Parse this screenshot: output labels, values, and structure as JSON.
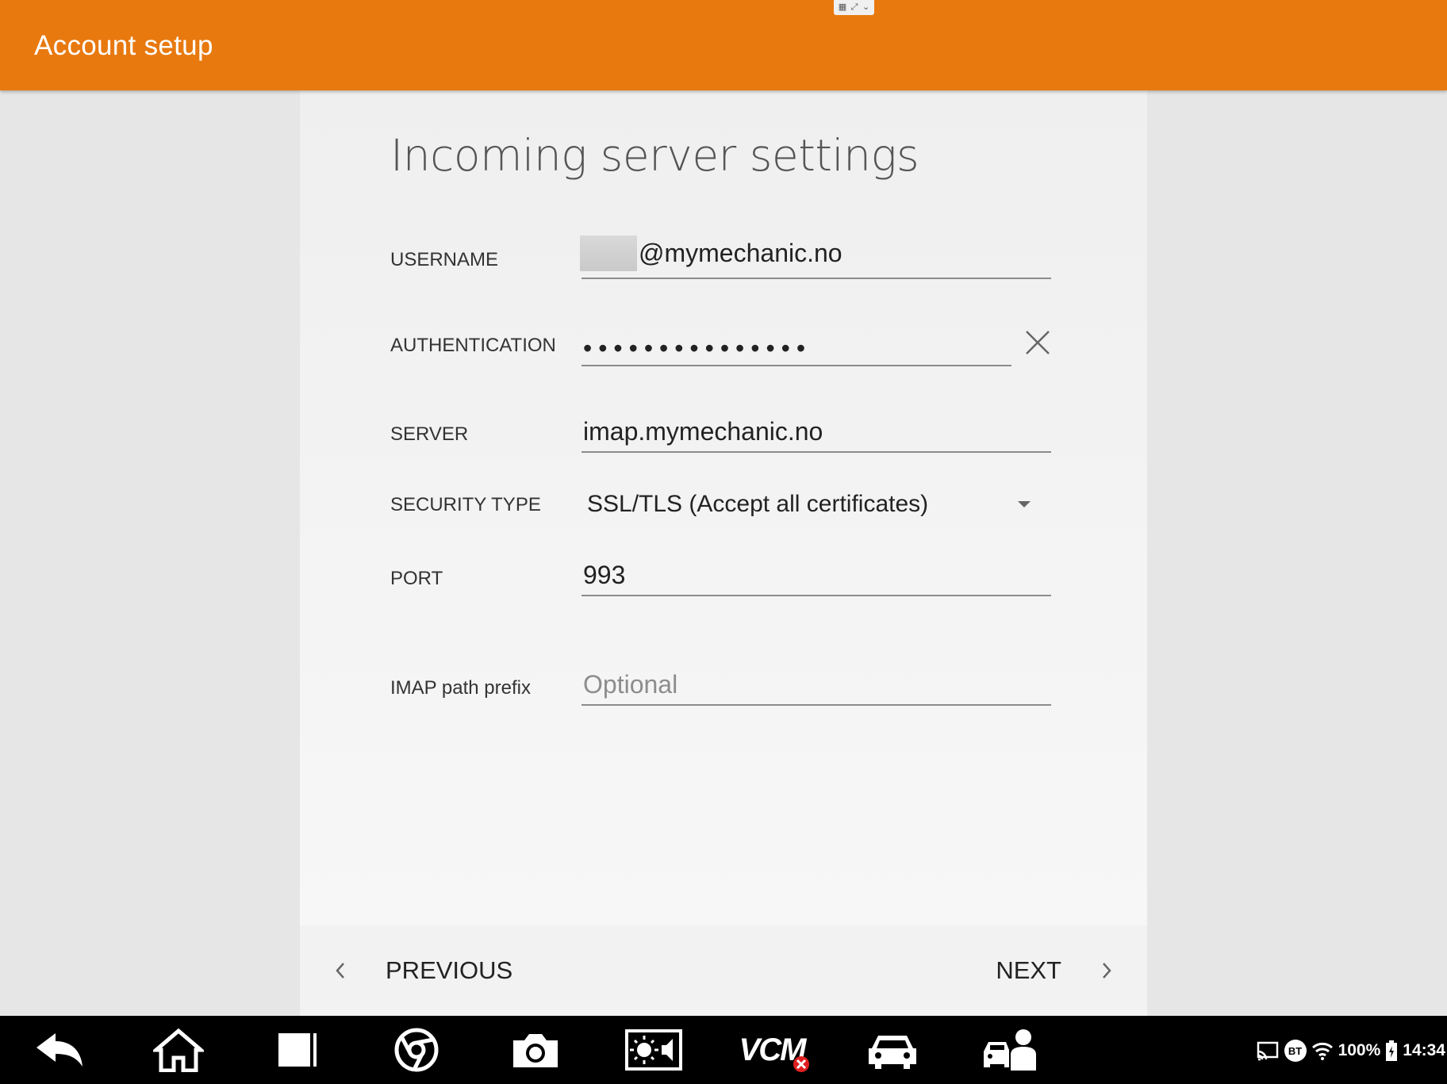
{
  "appbar": {
    "title": "Account setup"
  },
  "form": {
    "heading": "Incoming server settings",
    "username": {
      "label": "USERNAME",
      "value": "@mymechanic.no"
    },
    "authentication": {
      "label": "AUTHENTICATION",
      "value": "•••••••••••••••"
    },
    "server": {
      "label": "SERVER",
      "value": "imap.mymechanic.no"
    },
    "security_type": {
      "label": "SECURITY TYPE",
      "value": "SSL/TLS (Accept all certificates)"
    },
    "port": {
      "label": "PORT",
      "value": "993"
    },
    "imap_prefix": {
      "label": "IMAP path prefix",
      "placeholder": "Optional"
    }
  },
  "navigation": {
    "previous": "PREVIOUS",
    "next": "NEXT"
  },
  "taskbar": {
    "icons": [
      "back-icon",
      "home-icon",
      "recent-apps-icon",
      "chrome-icon",
      "camera-icon",
      "screen-brightness-icon",
      "vcm-icon",
      "car-icon",
      "mechanic-icon"
    ],
    "vcm_label": "VCM",
    "status": {
      "bt": "BT",
      "battery": "100%",
      "time": "14:34"
    }
  },
  "colors": {
    "accent": "#e8790f",
    "taskbar": "#000000"
  }
}
